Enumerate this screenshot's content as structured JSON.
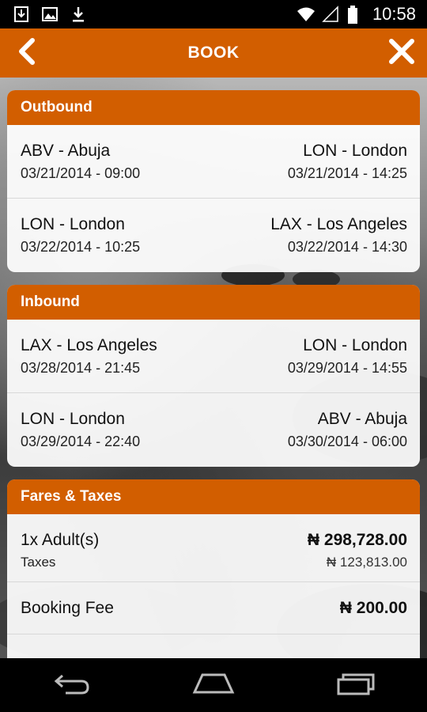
{
  "status_bar": {
    "time": "10:58",
    "icons": [
      "download-icon",
      "image-icon",
      "download-arrow-icon",
      "wifi-icon",
      "signal-icon",
      "battery-icon"
    ]
  },
  "header": {
    "title": "BOOK",
    "back_icon": "chevron-left-icon",
    "close_icon": "close-icon"
  },
  "outbound": {
    "title": "Outbound",
    "legs": [
      {
        "from": "ABV - Abuja",
        "dep": "03/21/2014 - 09:00",
        "to": "LON - London",
        "arr": "03/21/2014 - 14:25"
      },
      {
        "from": "LON - London",
        "dep": "03/22/2014 - 10:25",
        "to": "LAX - Los Angeles",
        "arr": "03/22/2014 - 14:30"
      }
    ]
  },
  "inbound": {
    "title": "Inbound",
    "legs": [
      {
        "from": "LAX - Los Angeles",
        "dep": "03/28/2014 - 21:45",
        "to": "LON - London",
        "arr": "03/29/2014 - 14:55"
      },
      {
        "from": "LON - London",
        "dep": "03/29/2014 - 22:40",
        "to": "ABV - Abuja",
        "arr": "03/30/2014 - 06:00"
      }
    ]
  },
  "fares": {
    "title": "Fares & Taxes",
    "passenger_label": "1x Adult(s)",
    "passenger_price": "₦ 298,728.00",
    "taxes_label": "Taxes",
    "taxes_price": "₦ 123,813.00",
    "fee_label": "Booking Fee",
    "fee_price": "₦ 200.00"
  },
  "colors": {
    "accent": "#d25e00",
    "card_bg": "#ffffff"
  }
}
